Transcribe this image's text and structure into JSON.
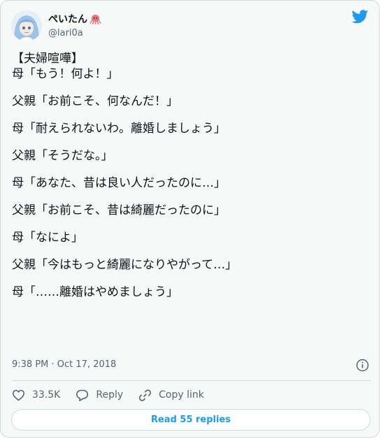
{
  "author": {
    "display_name": "ぺいたん",
    "handle": "@lari0a",
    "name_emoji_icon": "octopus-icon"
  },
  "tweet": {
    "lines": [
      "【夫婦喧嘩】",
      "母「もう！何よ！」",
      "",
      "父親「お前こそ、何なんだ！」",
      "",
      "母「耐えられないわ。離婚しましょう」",
      "",
      "父親「そうだな。」",
      "",
      "母「あなた、昔は良い人だったのに…」",
      "",
      "父親「お前こそ、昔は綺麗だったのに」",
      "",
      "母「なによ」",
      "",
      "父親「今はもっと綺麗になりやがって…」",
      "",
      "母「……離婚はやめましょう」"
    ],
    "timestamp": "9:38 PM · Oct 17, 2018"
  },
  "actions": {
    "like_count": "33.5K",
    "reply_label": "Reply",
    "copy_link_label": "Copy link"
  },
  "read_replies_label": "Read 55 replies",
  "colors": {
    "accent": "#1d9bf0",
    "text": "#0f1419",
    "secondary": "#536471",
    "border": "#cfd9de"
  },
  "icons": [
    "twitter-bird-icon",
    "info-icon",
    "heart-icon",
    "reply-bubble-icon",
    "link-icon",
    "octopus-icon"
  ]
}
